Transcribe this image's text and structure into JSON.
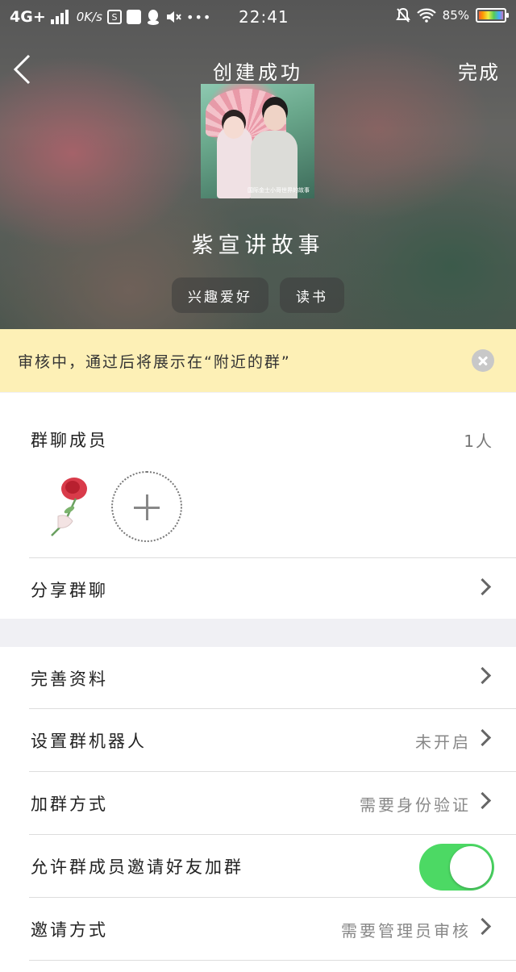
{
  "status_bar": {
    "network": "4G+",
    "speed": "0K/s",
    "time": "22:41",
    "battery": "85%"
  },
  "nav": {
    "title": "创建成功",
    "done_label": "完成"
  },
  "group": {
    "name": "紫宣讲故事",
    "cover_caption": "国际金士小哥世界的故事",
    "tags": [
      "兴趣爱好",
      "读书"
    ]
  },
  "notice": {
    "text": "审核中，通过后将展示在“附近的群”"
  },
  "members": {
    "label": "群聊成员",
    "count": "1人"
  },
  "rows": {
    "share": {
      "label": "分享群聊"
    },
    "profile": {
      "label": "完善资料"
    },
    "robot": {
      "label": "设置群机器人",
      "value": "未开启"
    },
    "join_method": {
      "label": "加群方式",
      "value": "需要身份验证"
    },
    "allow_invite": {
      "label": "允许群成员邀请好友加群",
      "enabled": true
    },
    "invite_method": {
      "label": "邀请方式",
      "value": "需要管理员审核"
    }
  },
  "colors": {
    "toggle_on": "#4cd964",
    "notice_bg": "#fdf0b6"
  }
}
